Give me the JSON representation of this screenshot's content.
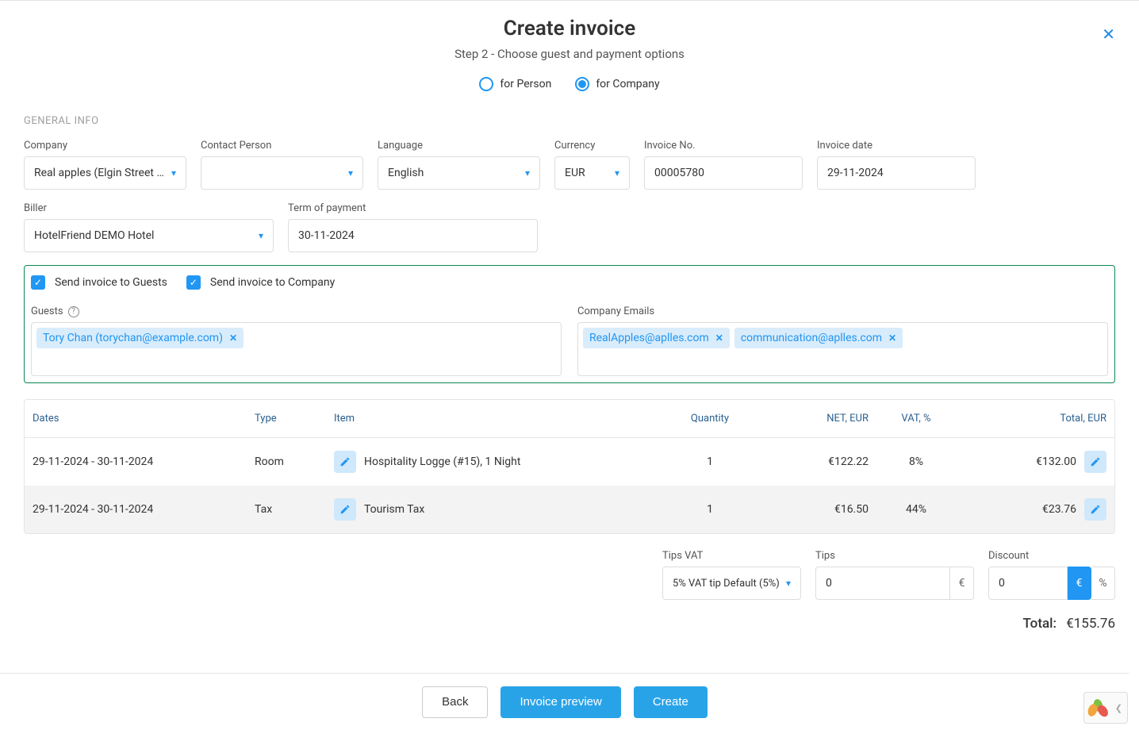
{
  "header": {
    "title": "Create invoice",
    "subtitle": "Step 2 - Choose guest and payment options"
  },
  "recipientType": {
    "person": {
      "label": "for Person",
      "selected": false
    },
    "company": {
      "label": "for Company",
      "selected": true
    }
  },
  "sectionGeneral": "GENERAL INFO",
  "fields": {
    "company": {
      "label": "Company",
      "value": "Real apples (Elgin Street ON"
    },
    "contactPerson": {
      "label": "Contact Person",
      "value": ""
    },
    "language": {
      "label": "Language",
      "value": "English"
    },
    "currency": {
      "label": "Currency",
      "value": "EUR"
    },
    "invoiceNo": {
      "label": "Invoice No.",
      "value": "00005780"
    },
    "invoiceDate": {
      "label": "Invoice date",
      "value": "29-11-2024"
    },
    "biller": {
      "label": "Biller",
      "value": "HotelFriend DEMO Hotel"
    },
    "termOfPayment": {
      "label": "Term of payment",
      "value": "30-11-2024"
    }
  },
  "send": {
    "toGuests": "Send invoice to Guests",
    "toCompany": "Send invoice to Company"
  },
  "guests": {
    "label": "Guests",
    "chips": [
      "Tory Chan (torychan@example.com)"
    ]
  },
  "companyEmails": {
    "label": "Company Emails",
    "chips": [
      "RealApples@aplles.com",
      "communication@aplles.com"
    ]
  },
  "tableHeaders": {
    "dates": "Dates",
    "type": "Type",
    "item": "Item",
    "quantity": "Quantity",
    "net": "NET, EUR",
    "vat": "VAT, %",
    "total": "Total, EUR"
  },
  "rows": [
    {
      "dates": "29-11-2024 - 30-11-2024",
      "type": "Room",
      "item": "Hospitality Logge  (#15), 1 Night",
      "qty": "1",
      "net": "€122.22",
      "vat": "8%",
      "total": "€132.00"
    },
    {
      "dates": "29-11-2024 - 30-11-2024",
      "type": "Tax",
      "item": "Tourism Tax",
      "qty": "1",
      "net": "€16.50",
      "vat": "44%",
      "total": "€23.76"
    }
  ],
  "totals": {
    "tipsVatLabel": "Tips VAT",
    "tipsVatValue": "5% VAT tip Default (5%)",
    "tipsLabel": "Tips",
    "tipsValue": "0",
    "tipsUnit": "€",
    "discountLabel": "Discount",
    "discountValue": "0",
    "discountUnitEur": "€",
    "discountUnitPct": "%"
  },
  "grandTotal": {
    "label": "Total:",
    "value": "€155.76"
  },
  "footer": {
    "back": "Back",
    "preview": "Invoice preview",
    "create": "Create"
  }
}
